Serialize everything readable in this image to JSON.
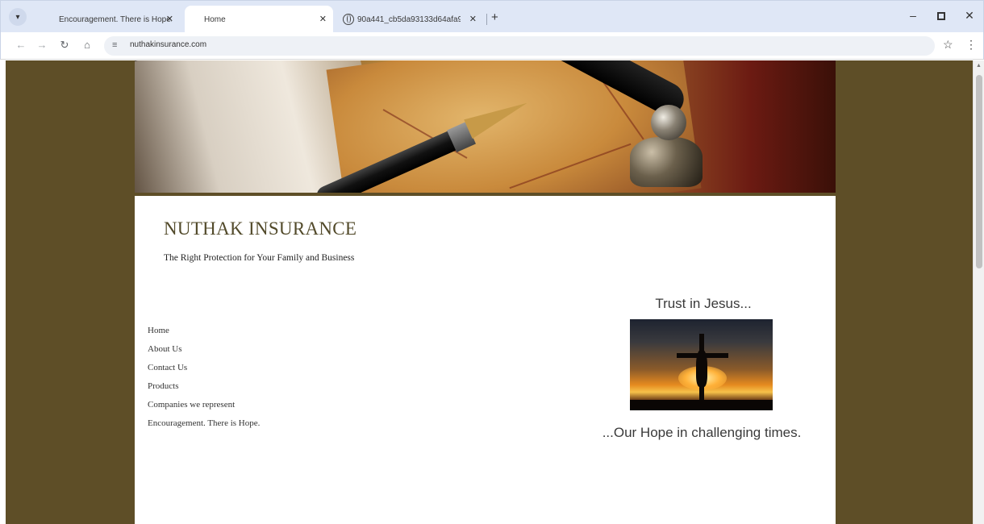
{
  "browser": {
    "tabs": [
      {
        "label": "Encouragement. There is Hope."
      },
      {
        "label": "Home"
      },
      {
        "label": "90a441_cb5da93133d64afa9939..."
      }
    ],
    "url": "nuthakinsurance.com",
    "icons": {
      "tab_search": "chevron-down-icon",
      "tab_close": "close-icon",
      "globe": "globe-icon",
      "new_tab": "plus-icon",
      "back": "arrow-left-icon",
      "forward": "arrow-right-icon",
      "reload": "reload-icon",
      "home": "home-icon",
      "site_info": "tune-icon",
      "bookmark": "star-icon",
      "menu": "more-vert-icon"
    }
  },
  "site": {
    "title": "NUTHAK INSURANCE",
    "tagline": "The Right Protection for Your Family and Business",
    "nav": [
      {
        "label": "Home"
      },
      {
        "label": "About Us"
      },
      {
        "label": "Contact Us"
      },
      {
        "label": "Products"
      },
      {
        "label": "Companies we represent"
      },
      {
        "label": "Encouragement. There is Hope."
      }
    ],
    "sidebar": {
      "top_text": "Trust in Jesus...",
      "bottom_text": "...Our Hope in challenging times."
    },
    "colors": {
      "background": "#5e4e27",
      "title": "#524a2a",
      "content": "#ffffff"
    }
  }
}
